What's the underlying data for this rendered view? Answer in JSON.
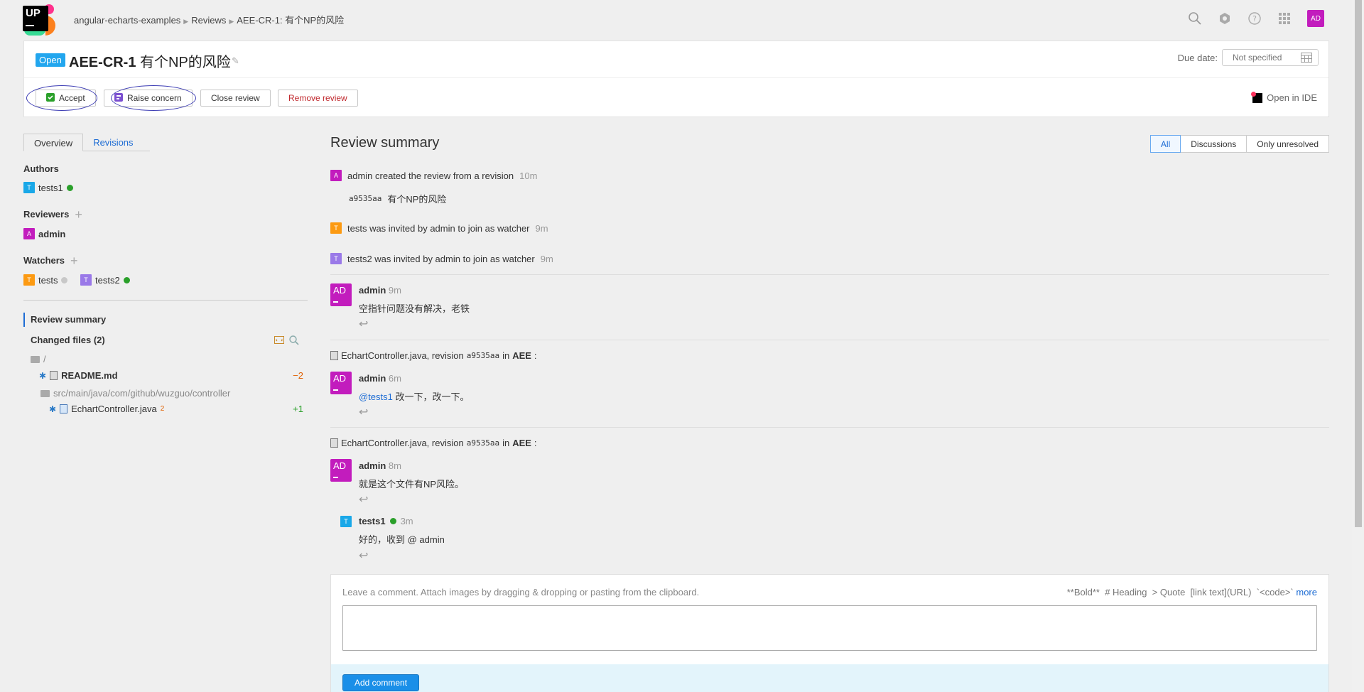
{
  "topbar": {
    "logo_text": "UP",
    "breadcrumbs": [
      "angular-echarts-examples",
      "Reviews",
      "AEE-CR-1: 有个NP的风险"
    ],
    "user_avatar": "AD"
  },
  "review": {
    "status": "Open",
    "id": "AEE-CR-1",
    "title": "有个NP的风险",
    "due_label": "Due date:",
    "due_value": "Not specified",
    "buttons": {
      "accept": "Accept",
      "raise_concern": "Raise concern",
      "close": "Close review",
      "remove": "Remove review"
    },
    "open_in_ide": "Open in IDE"
  },
  "sidebar": {
    "tabs": [
      "Overview",
      "Revisions"
    ],
    "authors_title": "Authors",
    "authors": [
      {
        "initial": "T",
        "name": "tests1",
        "status": "online"
      }
    ],
    "reviewers_title": "Reviewers",
    "reviewers": [
      {
        "initial": "A",
        "name": "admin"
      }
    ],
    "watchers_title": "Watchers",
    "watchers": [
      {
        "initial": "T",
        "name": "tests",
        "status": "offline"
      },
      {
        "initial": "T",
        "name": "tests2",
        "status": "online"
      }
    ],
    "nav_summary": "Review summary",
    "changed_files_title": "Changed files (2)",
    "root_folder": "/",
    "files": [
      {
        "name": "README.md",
        "delta": "−2"
      },
      {
        "folder": "src/main/java/com/github/wuzguo/controller"
      },
      {
        "name": "EchartController.java",
        "badge": "2",
        "delta": "+1"
      }
    ]
  },
  "summary": {
    "title": "Review summary",
    "filters": [
      "All",
      "Discussions",
      "Only unresolved"
    ],
    "events": [
      {
        "avatar": "A",
        "text": "admin created the review from a revision",
        "time": "10m"
      },
      {
        "revision": "a9535aa",
        "message": "有个NP的风险"
      },
      {
        "avatar": "T",
        "text": "tests was invited by admin to join as watcher",
        "time": "9m"
      },
      {
        "avatar": "T",
        "text": "tests2 was invited by admin to join as watcher",
        "time": "9m"
      }
    ],
    "comments": [
      {
        "avatar": "AD",
        "author": "admin",
        "time": "9m",
        "text": "空指针问题没有解决，老铁"
      },
      {
        "file": "EchartController.java, revision",
        "rev": "a9535aa",
        "in_text": "in",
        "project": "AEE",
        "colon": ":",
        "avatar": "AD",
        "author": "admin",
        "time": "6m",
        "mention": "@tests1",
        "text": "改一下，改一下。"
      },
      {
        "file": "EchartController.java, revision",
        "rev": "a9535aa",
        "in_text": "in",
        "project": "AEE",
        "colon": ":",
        "avatar": "AD",
        "author": "admin",
        "time": "8m",
        "text": "就是这个文件有NP风险。",
        "reply": {
          "avatar": "T",
          "author": "tests1",
          "time": "3m",
          "text": "好的，收到 @ admin"
        }
      }
    ],
    "composer": {
      "hint": "Leave a comment. Attach images by dragging & dropping or pasting from the clipboard.",
      "markdown_hints": "**Bold**  # Heading  > Quote  [link text](URL)  `<code>`",
      "more": "more",
      "submit": "Add comment"
    }
  },
  "colors": {
    "accent": "#1d6cd4",
    "open_badge": "#22a6ee",
    "admin_avatar": "#c21cbd",
    "tests1_avatar": "#1aa8e8",
    "tests_avatar": "#fc9a12",
    "tests2_avatar": "#9a79e8",
    "online": "#2aa02a",
    "offline": "#c8c8c8"
  }
}
